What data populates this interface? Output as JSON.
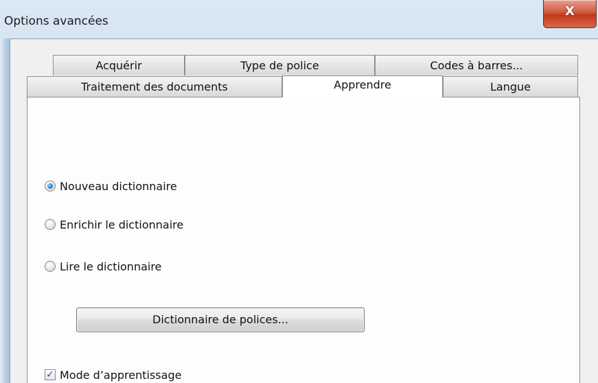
{
  "window": {
    "title": "Options avancées",
    "close_glyph": "X"
  },
  "tabs": {
    "row_top": [
      {
        "label": "Acquérir"
      },
      {
        "label": "Type de police"
      },
      {
        "label": "Codes à barres..."
      }
    ],
    "row_bottom": [
      {
        "label": "Traitement des documents"
      },
      {
        "label": "Apprendre",
        "active": true
      },
      {
        "label": "Langue"
      }
    ]
  },
  "learn_panel": {
    "radios": [
      {
        "label": "Nouveau dictionnaire",
        "checked": true
      },
      {
        "label": "Enrichir le dictionnaire",
        "checked": false
      },
      {
        "label": "Lire le dictionnaire",
        "checked": false
      }
    ],
    "font_dictionary_button": "Dictionnaire de polices...",
    "learning_mode": {
      "label": "Mode d’apprentissage",
      "checked": true,
      "check_glyph": "✓"
    }
  },
  "colors": {
    "close_button": "#c0391b",
    "radio_dot": "#2a7fd4",
    "check_mark": "#2b4d9e"
  },
  "icons": [
    "close-icon",
    "radio-selected",
    "radio-unselected",
    "checkbox-checked"
  ]
}
